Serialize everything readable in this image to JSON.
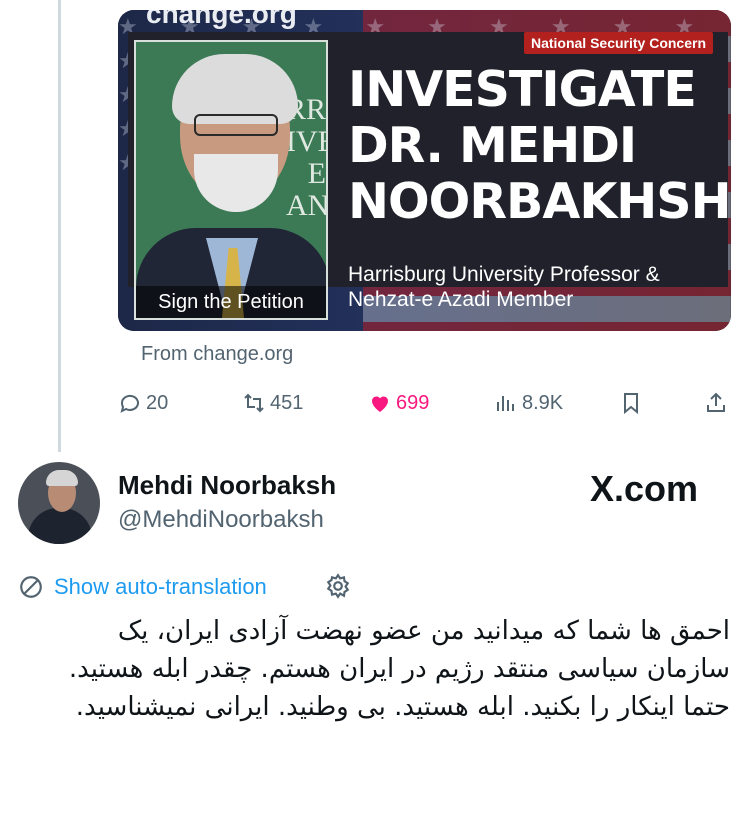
{
  "card": {
    "brand": "change.org",
    "badge": "National Security Concern",
    "headline": "INVESTIGATE DR. MEHDI NOORBAKHSH",
    "subtitle": "Harrisburg University Professor & Nehzat-e Azadi Member",
    "photo_caption": "Sign the Petition",
    "photo_bg_letters": "RRIS IVE E AN",
    "source": "From change.org"
  },
  "actions": {
    "replies": "20",
    "reposts": "451",
    "likes": "699",
    "views": "8.9K"
  },
  "reply": {
    "name": "Mehdi Noorbaksh",
    "handle": "@MehdiNoorbaksh",
    "watermark": "X.com",
    "translate_label": "Show auto-translation",
    "text": "احمق ها شما که میدانید من عضو نهضت آزادی ایران، یک سازمان سیاسی منتقد رژیم در ایران هستم. چقدر ابله هستید. حتما اینکار را بکنید. ابله هستید. بی وطنید. ایرانی نمیشناسید."
  },
  "colors": {
    "like": "#f91880",
    "link": "#1d9bf0",
    "muted": "#536471",
    "badge": "#b3211e"
  }
}
